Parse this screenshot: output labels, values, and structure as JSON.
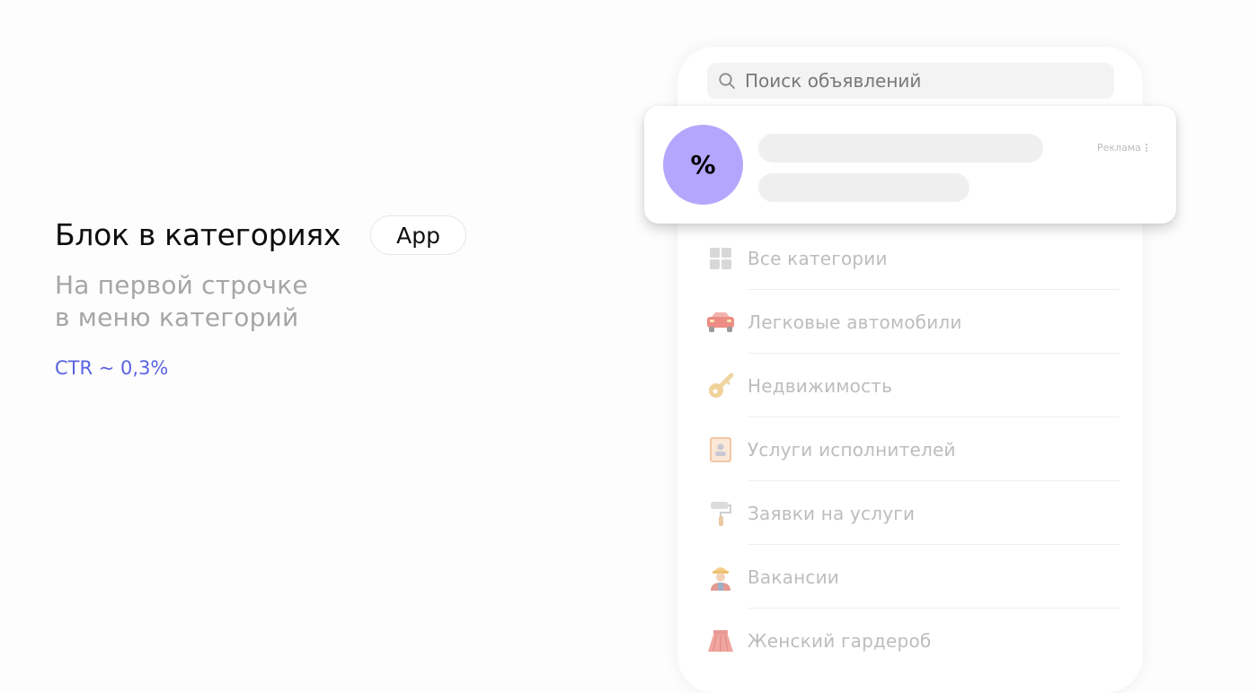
{
  "info": {
    "title": "Блок в категориях",
    "badge": "App",
    "subtitle_line1": "На первой строчке",
    "subtitle_line2": "в меню категорий",
    "metric": "CTR ~ 0,3%"
  },
  "search": {
    "placeholder": "Поиск объявлений",
    "icon": "search-icon"
  },
  "ad": {
    "avatar_text": "%",
    "label": "Реклама",
    "menu_icon": "kebab-menu-icon"
  },
  "categories": [
    {
      "label": "Все категории",
      "icon": "grid-icon"
    },
    {
      "label": "Легковые автомобили",
      "icon": "car-icon"
    },
    {
      "label": "Недвижимость",
      "icon": "key-icon"
    },
    {
      "label": "Услуги исполнителей",
      "icon": "id-badge-icon"
    },
    {
      "label": "Заявки на услуги",
      "icon": "paint-roller-icon"
    },
    {
      "label": "Вакансии",
      "icon": "worker-icon"
    },
    {
      "label": "Женский гардероб",
      "icon": "skirt-icon"
    }
  ],
  "colors": {
    "accent": "#5a63e3",
    "avatar": "#b5a6fd",
    "muted_text": "#a6a6a6"
  }
}
